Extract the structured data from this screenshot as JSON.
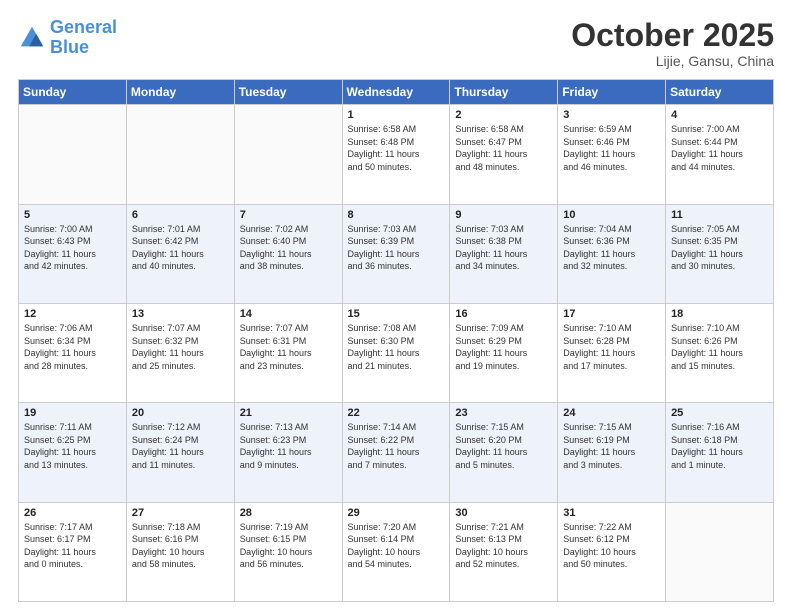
{
  "header": {
    "logo_line1": "General",
    "logo_line2": "Blue",
    "month": "October 2025",
    "location": "Lijie, Gansu, China"
  },
  "weekdays": [
    "Sunday",
    "Monday",
    "Tuesday",
    "Wednesday",
    "Thursday",
    "Friday",
    "Saturday"
  ],
  "weeks": [
    [
      {
        "day": "",
        "info": ""
      },
      {
        "day": "",
        "info": ""
      },
      {
        "day": "",
        "info": ""
      },
      {
        "day": "1",
        "info": "Sunrise: 6:58 AM\nSunset: 6:48 PM\nDaylight: 11 hours\nand 50 minutes."
      },
      {
        "day": "2",
        "info": "Sunrise: 6:58 AM\nSunset: 6:47 PM\nDaylight: 11 hours\nand 48 minutes."
      },
      {
        "day": "3",
        "info": "Sunrise: 6:59 AM\nSunset: 6:46 PM\nDaylight: 11 hours\nand 46 minutes."
      },
      {
        "day": "4",
        "info": "Sunrise: 7:00 AM\nSunset: 6:44 PM\nDaylight: 11 hours\nand 44 minutes."
      }
    ],
    [
      {
        "day": "5",
        "info": "Sunrise: 7:00 AM\nSunset: 6:43 PM\nDaylight: 11 hours\nand 42 minutes."
      },
      {
        "day": "6",
        "info": "Sunrise: 7:01 AM\nSunset: 6:42 PM\nDaylight: 11 hours\nand 40 minutes."
      },
      {
        "day": "7",
        "info": "Sunrise: 7:02 AM\nSunset: 6:40 PM\nDaylight: 11 hours\nand 38 minutes."
      },
      {
        "day": "8",
        "info": "Sunrise: 7:03 AM\nSunset: 6:39 PM\nDaylight: 11 hours\nand 36 minutes."
      },
      {
        "day": "9",
        "info": "Sunrise: 7:03 AM\nSunset: 6:38 PM\nDaylight: 11 hours\nand 34 minutes."
      },
      {
        "day": "10",
        "info": "Sunrise: 7:04 AM\nSunset: 6:36 PM\nDaylight: 11 hours\nand 32 minutes."
      },
      {
        "day": "11",
        "info": "Sunrise: 7:05 AM\nSunset: 6:35 PM\nDaylight: 11 hours\nand 30 minutes."
      }
    ],
    [
      {
        "day": "12",
        "info": "Sunrise: 7:06 AM\nSunset: 6:34 PM\nDaylight: 11 hours\nand 28 minutes."
      },
      {
        "day": "13",
        "info": "Sunrise: 7:07 AM\nSunset: 6:32 PM\nDaylight: 11 hours\nand 25 minutes."
      },
      {
        "day": "14",
        "info": "Sunrise: 7:07 AM\nSunset: 6:31 PM\nDaylight: 11 hours\nand 23 minutes."
      },
      {
        "day": "15",
        "info": "Sunrise: 7:08 AM\nSunset: 6:30 PM\nDaylight: 11 hours\nand 21 minutes."
      },
      {
        "day": "16",
        "info": "Sunrise: 7:09 AM\nSunset: 6:29 PM\nDaylight: 11 hours\nand 19 minutes."
      },
      {
        "day": "17",
        "info": "Sunrise: 7:10 AM\nSunset: 6:28 PM\nDaylight: 11 hours\nand 17 minutes."
      },
      {
        "day": "18",
        "info": "Sunrise: 7:10 AM\nSunset: 6:26 PM\nDaylight: 11 hours\nand 15 minutes."
      }
    ],
    [
      {
        "day": "19",
        "info": "Sunrise: 7:11 AM\nSunset: 6:25 PM\nDaylight: 11 hours\nand 13 minutes."
      },
      {
        "day": "20",
        "info": "Sunrise: 7:12 AM\nSunset: 6:24 PM\nDaylight: 11 hours\nand 11 minutes."
      },
      {
        "day": "21",
        "info": "Sunrise: 7:13 AM\nSunset: 6:23 PM\nDaylight: 11 hours\nand 9 minutes."
      },
      {
        "day": "22",
        "info": "Sunrise: 7:14 AM\nSunset: 6:22 PM\nDaylight: 11 hours\nand 7 minutes."
      },
      {
        "day": "23",
        "info": "Sunrise: 7:15 AM\nSunset: 6:20 PM\nDaylight: 11 hours\nand 5 minutes."
      },
      {
        "day": "24",
        "info": "Sunrise: 7:15 AM\nSunset: 6:19 PM\nDaylight: 11 hours\nand 3 minutes."
      },
      {
        "day": "25",
        "info": "Sunrise: 7:16 AM\nSunset: 6:18 PM\nDaylight: 11 hours\nand 1 minute."
      }
    ],
    [
      {
        "day": "26",
        "info": "Sunrise: 7:17 AM\nSunset: 6:17 PM\nDaylight: 11 hours\nand 0 minutes."
      },
      {
        "day": "27",
        "info": "Sunrise: 7:18 AM\nSunset: 6:16 PM\nDaylight: 10 hours\nand 58 minutes."
      },
      {
        "day": "28",
        "info": "Sunrise: 7:19 AM\nSunset: 6:15 PM\nDaylight: 10 hours\nand 56 minutes."
      },
      {
        "day": "29",
        "info": "Sunrise: 7:20 AM\nSunset: 6:14 PM\nDaylight: 10 hours\nand 54 minutes."
      },
      {
        "day": "30",
        "info": "Sunrise: 7:21 AM\nSunset: 6:13 PM\nDaylight: 10 hours\nand 52 minutes."
      },
      {
        "day": "31",
        "info": "Sunrise: 7:22 AM\nSunset: 6:12 PM\nDaylight: 10 hours\nand 50 minutes."
      },
      {
        "day": "",
        "info": ""
      }
    ]
  ]
}
